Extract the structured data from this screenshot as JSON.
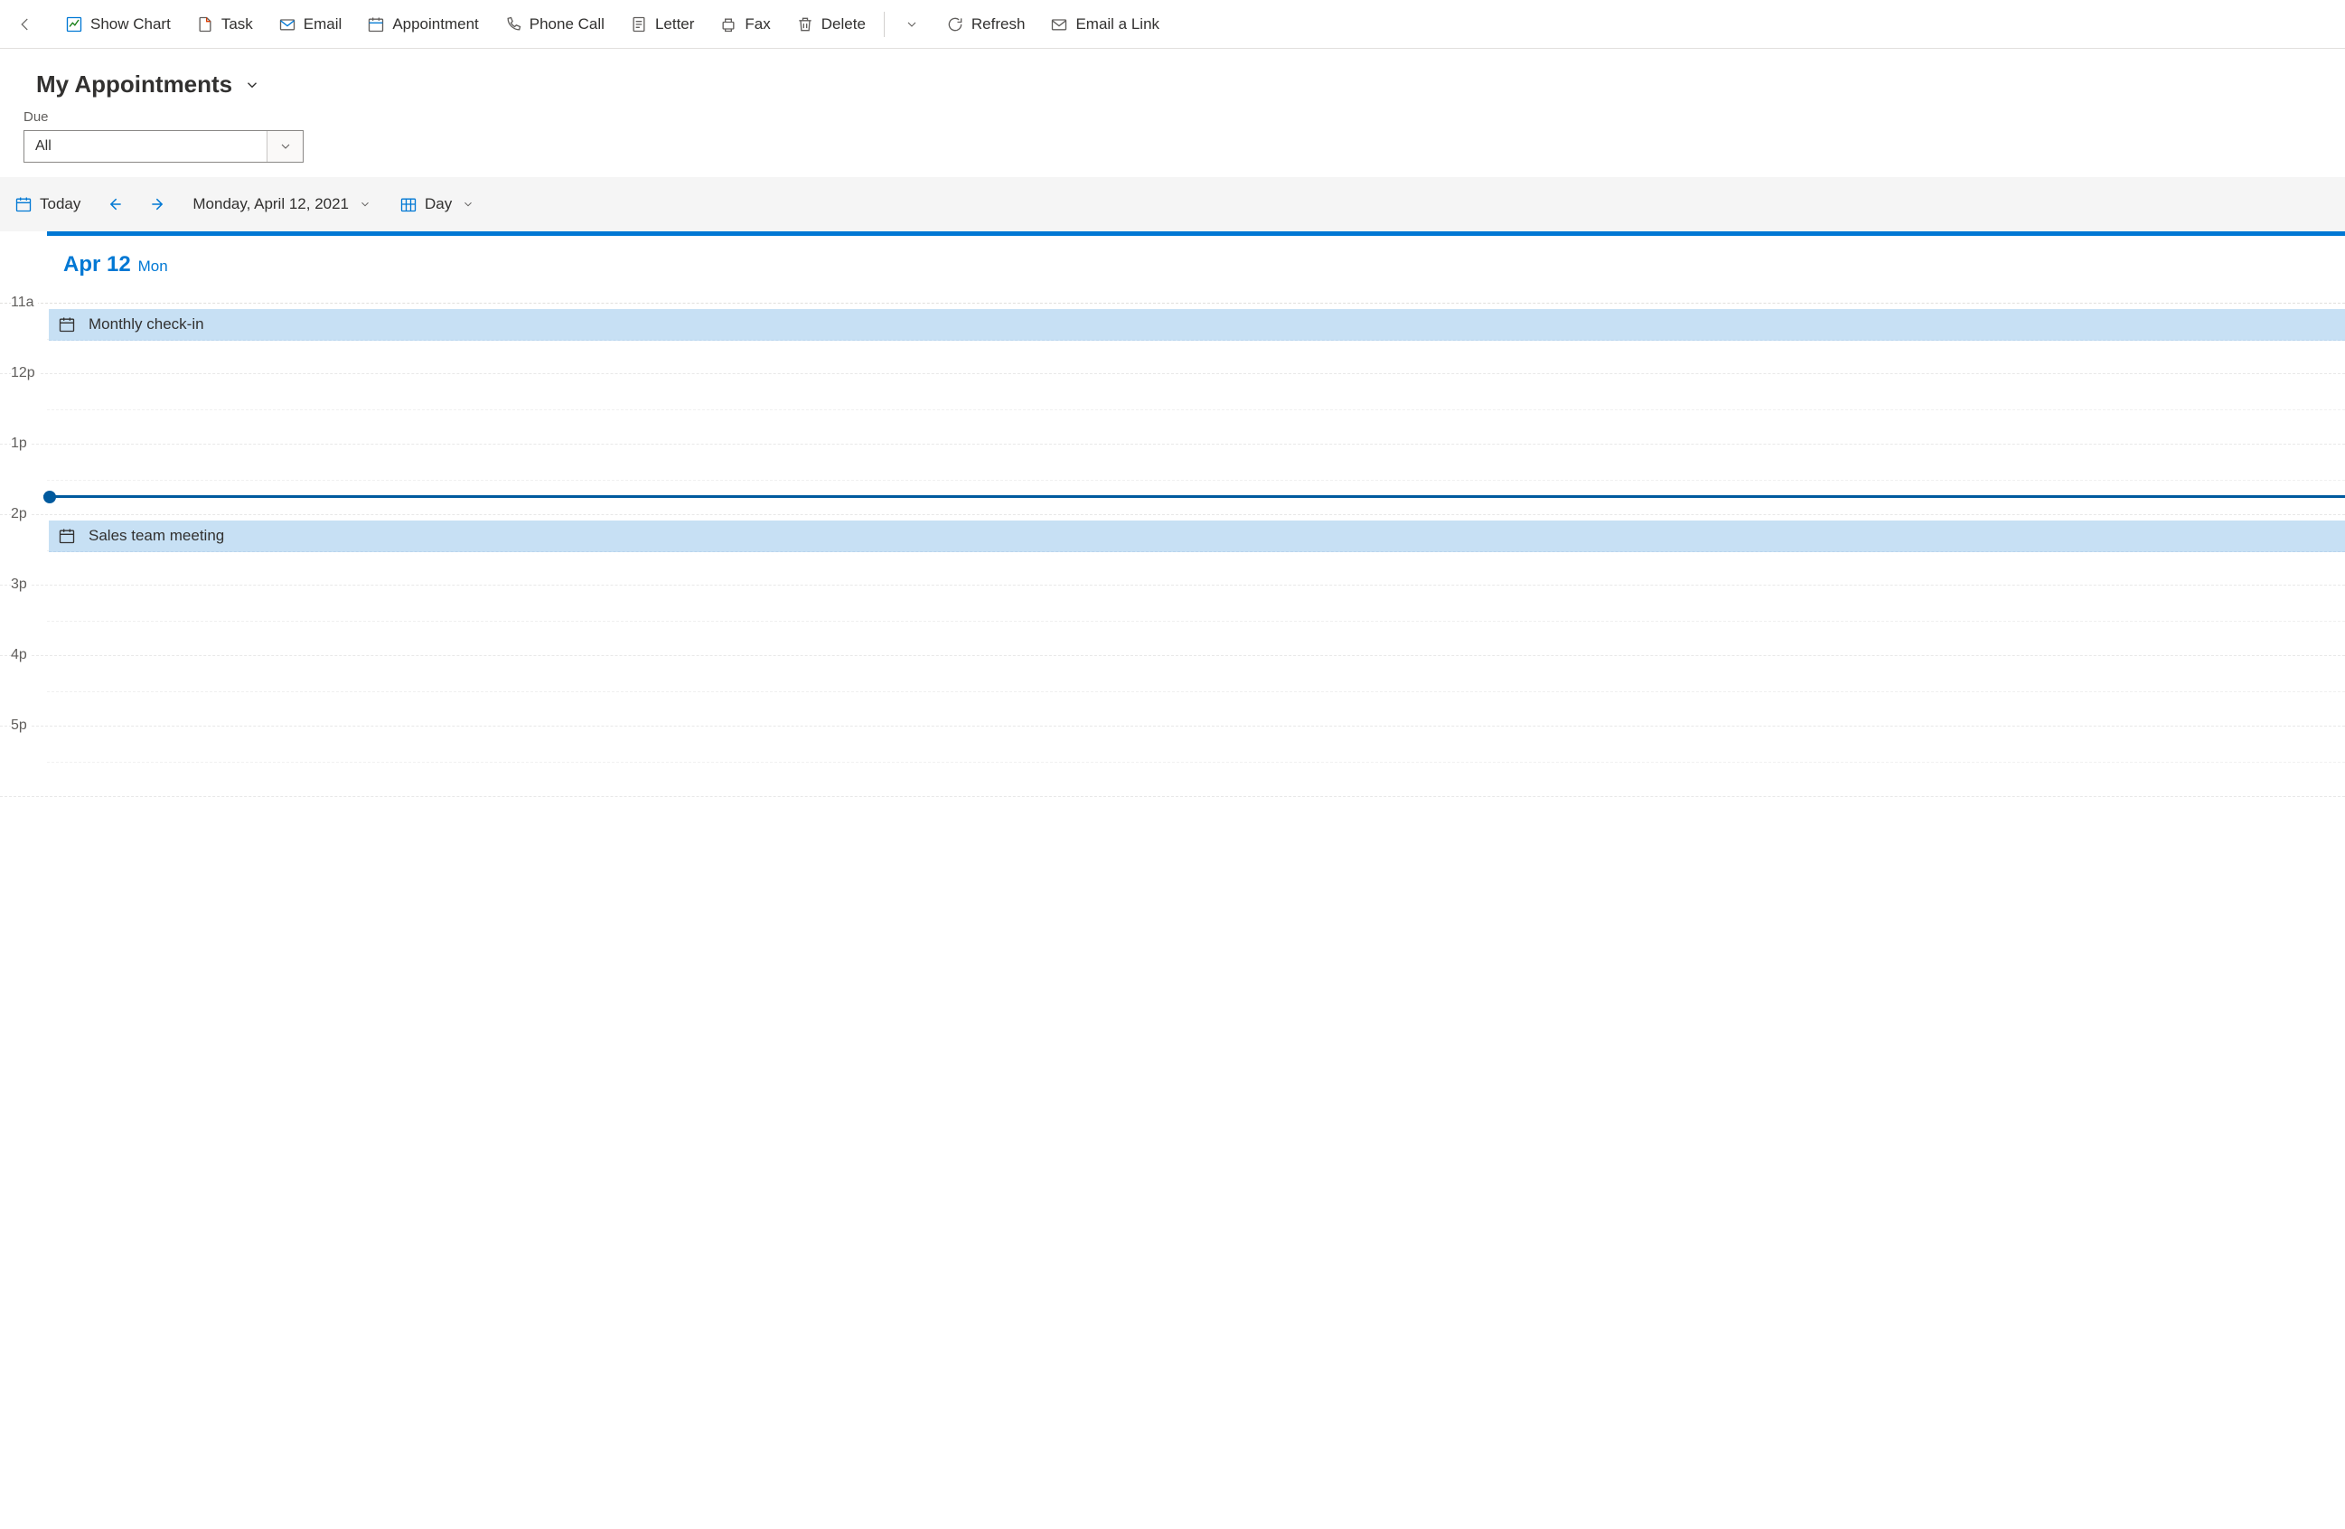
{
  "toolbar": {
    "show_chart": "Show Chart",
    "task": "Task",
    "email": "Email",
    "appointment": "Appointment",
    "phone_call": "Phone Call",
    "letter": "Letter",
    "fax": "Fax",
    "delete": "Delete",
    "refresh": "Refresh",
    "email_link": "Email a Link"
  },
  "view": {
    "title": "My Appointments"
  },
  "filter": {
    "due_label": "Due",
    "due_value": "All"
  },
  "calnav": {
    "today": "Today",
    "date_text": "Monday, April 12, 2021",
    "view_mode": "Day"
  },
  "calendar": {
    "day_date": "Apr 12",
    "day_name": "Mon",
    "hours": [
      "11a",
      "12p",
      "1p",
      "2p",
      "3p",
      "4p",
      "5p"
    ],
    "appointments": [
      {
        "title": "Monthly check-in",
        "row": 0,
        "half": 0
      },
      {
        "title": "Sales team meeting",
        "row": 3,
        "half": 0
      }
    ],
    "now_row": 2,
    "now_offset": 0.72
  }
}
